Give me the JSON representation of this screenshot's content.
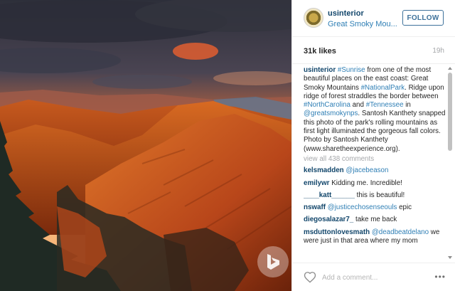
{
  "post": {
    "username": "usinterior",
    "location": "Great Smoky Mou...",
    "follow_label": "FOLLOW",
    "likes": "31k likes",
    "time_ago": "19h"
  },
  "caption": {
    "user": "usinterior",
    "parts": [
      {
        "text": " ",
        "type": "txt"
      },
      {
        "text": "#Sunrise",
        "type": "tag"
      },
      {
        "text": " from one of the most beautiful places on the east coast: Great Smoky Mountains ",
        "type": "txt"
      },
      {
        "text": "#NationalPark",
        "type": "tag"
      },
      {
        "text": ". Ridge upon ridge of forest straddles the border between ",
        "type": "txt"
      },
      {
        "text": "#NorthCarolina",
        "type": "tag"
      },
      {
        "text": " and ",
        "type": "txt"
      },
      {
        "text": "#Tennessee",
        "type": "tag"
      },
      {
        "text": " in ",
        "type": "txt"
      },
      {
        "text": "@greatsmokynps",
        "type": "tag"
      },
      {
        "text": ". Santosh Kanthety snapped this photo of the park's rolling mountains as first light illuminated the gorgeous fall colors. Photo by Santosh Kanthety (www.sharetheexperience.org).",
        "type": "txt"
      }
    ]
  },
  "view_all": "view all 438 comments",
  "comments": [
    {
      "user": "kelsmadden",
      "mention": "@jacebeason",
      "text": ""
    },
    {
      "user": "emilywr",
      "mention": "",
      "text": "Kidding me. Incredible!"
    },
    {
      "user": "____katt______",
      "mention": "",
      "text": "this is beautiful!"
    },
    {
      "user": "nswaff",
      "mention": "@justicechosenseouls",
      "text": " epic"
    },
    {
      "user": "diegosalazar7_",
      "mention": "",
      "text": "take me back"
    },
    {
      "user": "msduttonlovesmath",
      "mention": "@deadbeatdelano",
      "text": " we were just in that area where my mom"
    }
  ],
  "footer": {
    "add_comment_placeholder": "Add a comment...",
    "more_label": "•••"
  },
  "icons": {
    "heart": "heart-icon",
    "watermark": "bing-watermark-icon"
  },
  "colors": {
    "username": "#12466b",
    "link": "#2f7fb5",
    "follow": "#3f729b",
    "muted": "#a5a7aa"
  }
}
